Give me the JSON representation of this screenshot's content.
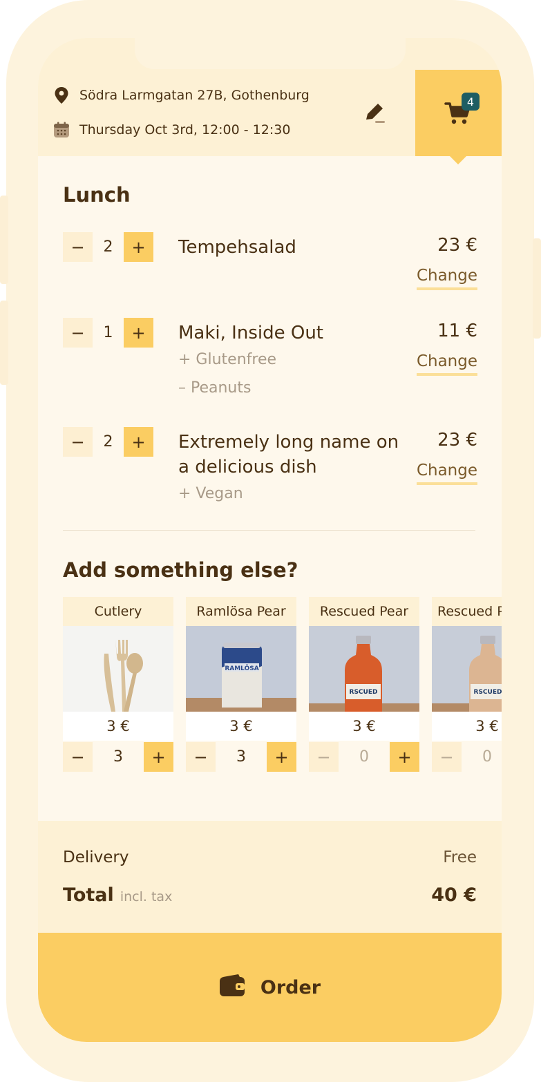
{
  "header": {
    "address": "Södra Larmgatan 27B, Gothenburg",
    "datetime": "Thursday Oct 3rd, 12:00 - 12:30",
    "cart_count": "4",
    "icons": [
      "location-pin-icon",
      "calendar-icon",
      "edit-pencil-icon",
      "cart-icon"
    ]
  },
  "lunch": {
    "title": "Lunch",
    "items": [
      {
        "qty": "2",
        "name": "Tempehsalad",
        "mods": [],
        "price": "23 €",
        "change": "Change"
      },
      {
        "qty": "1",
        "name": "Maki, Inside Out",
        "mods": [
          "+ Glutenfree",
          "– Peanuts"
        ],
        "price": "11 €",
        "change": "Change"
      },
      {
        "qty": "2",
        "name": "Extremely long name on a delicious dish",
        "mods": [
          "+ Vegan"
        ],
        "price": "23 €",
        "change": "Change"
      }
    ]
  },
  "addons": {
    "title": "Add something else?",
    "items": [
      {
        "name": "Cutlery",
        "price": "3 €",
        "qty": "3"
      },
      {
        "name": "Ramlösa Pear",
        "price": "3 €",
        "qty": "3"
      },
      {
        "name": "Rescued Pear",
        "price": "3 €",
        "qty": "0"
      },
      {
        "name": "Rescued Pear",
        "price": "3 €",
        "qty": "0"
      }
    ],
    "minus": "−",
    "plus": "+"
  },
  "summary": {
    "delivery_label": "Delivery",
    "delivery_value": "Free",
    "total_label": "Total",
    "total_note": "incl. tax",
    "total_value": "40 €"
  },
  "order_button": {
    "label": "Order",
    "icon": "wallet-icon"
  },
  "colors": {
    "accent": "#fbcd62",
    "background": "#fef8ec",
    "header": "#fdf1d5",
    "text": "#4a3114",
    "badge": "#1e5d63"
  }
}
